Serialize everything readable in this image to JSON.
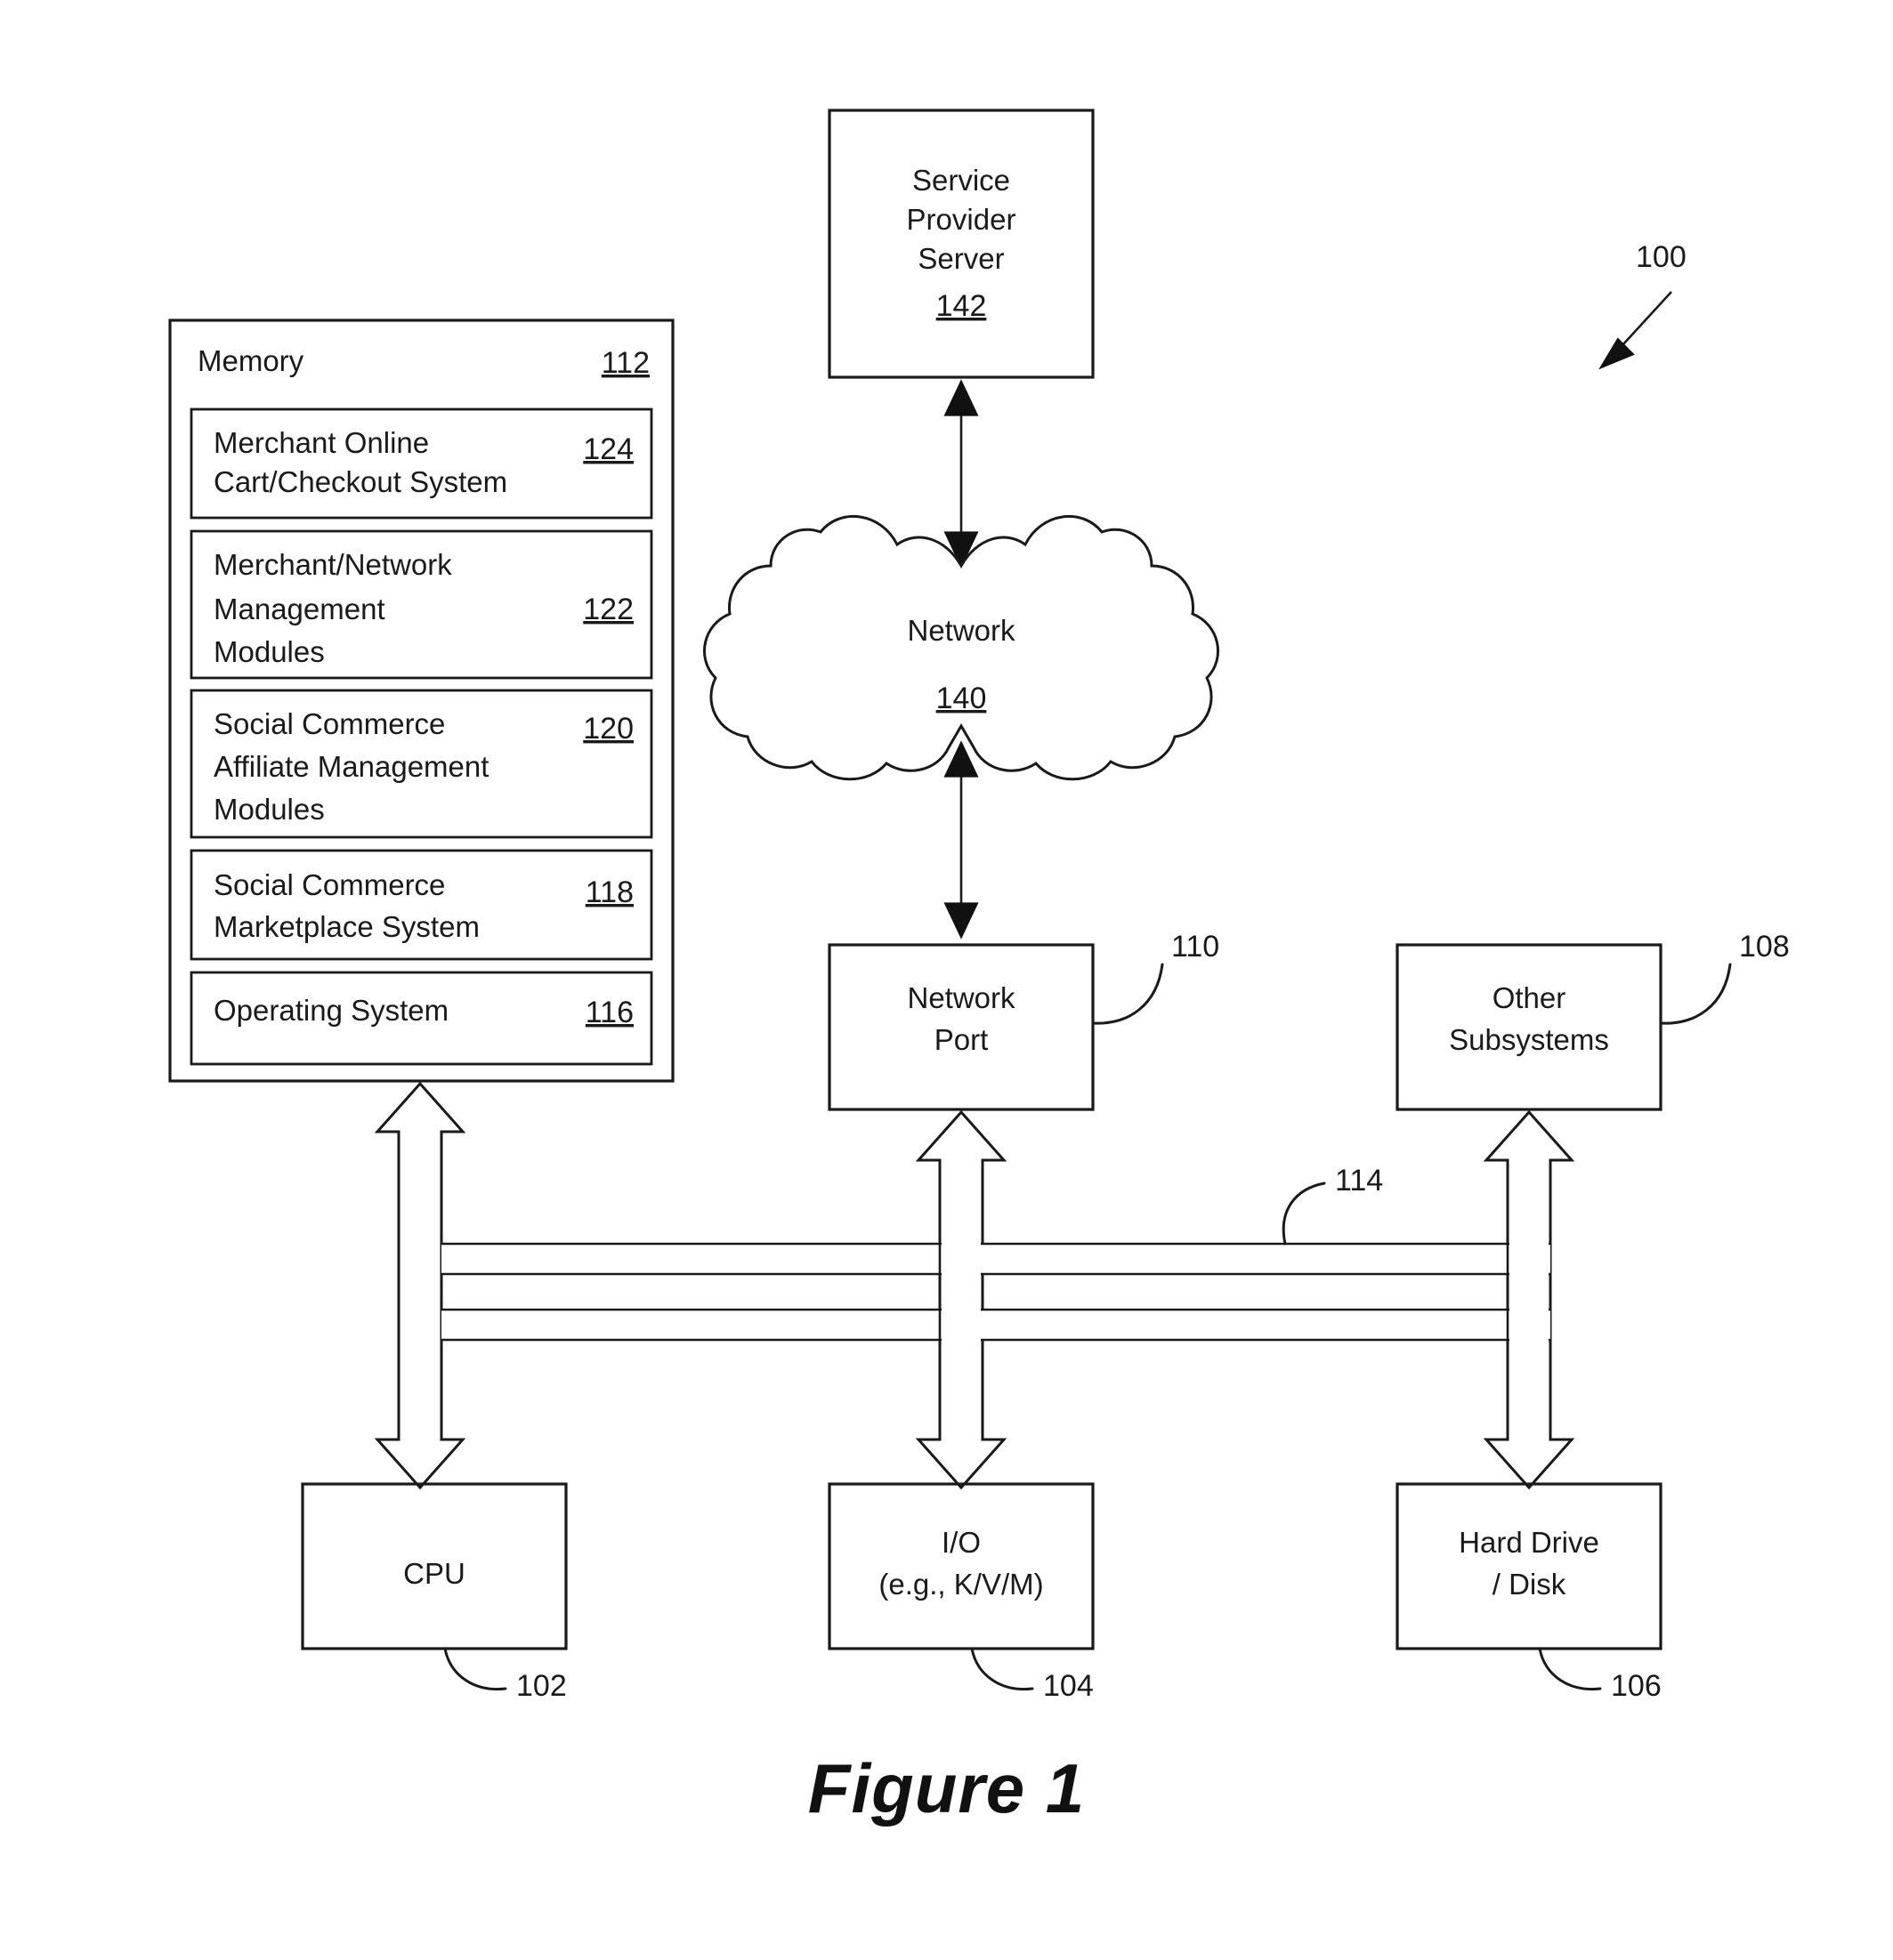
{
  "figure": {
    "caption": "Figure 1",
    "system_ref": "100"
  },
  "memory": {
    "title": "Memory",
    "ref": "112",
    "modules": [
      {
        "lines": [
          "Merchant Online",
          "Cart/Checkout System"
        ],
        "ref": "124"
      },
      {
        "lines": [
          "Merchant/Network",
          "Management",
          "Modules"
        ],
        "ref": "122"
      },
      {
        "lines": [
          "Social Commerce",
          "Affiliate Management",
          "Modules"
        ],
        "ref": "120"
      },
      {
        "lines": [
          "Social Commerce",
          "Marketplace System"
        ],
        "ref": "118"
      },
      {
        "lines": [
          "Operating System"
        ],
        "ref": "116"
      }
    ]
  },
  "nodes": {
    "service_provider_server": {
      "lines": [
        "Service",
        "Provider",
        "Server"
      ],
      "ref": "142"
    },
    "network_cloud": {
      "label": "Network",
      "ref": "140"
    },
    "network_port": {
      "lines": [
        "Network",
        "Port"
      ],
      "ref": "110"
    },
    "other_subsystems": {
      "lines": [
        "Other",
        "Subsystems"
      ],
      "ref": "108"
    },
    "cpu": {
      "lines": [
        "CPU"
      ],
      "ref": "102"
    },
    "io": {
      "lines": [
        "I/O",
        "(e.g., K/V/M)"
      ],
      "ref": "104"
    },
    "hard_drive": {
      "lines": [
        "Hard Drive",
        "/ Disk"
      ],
      "ref": "106"
    }
  },
  "bus": {
    "ref": "114"
  },
  "colors": {
    "ink": "#1a1a1a",
    "paper": "#ffffff"
  }
}
